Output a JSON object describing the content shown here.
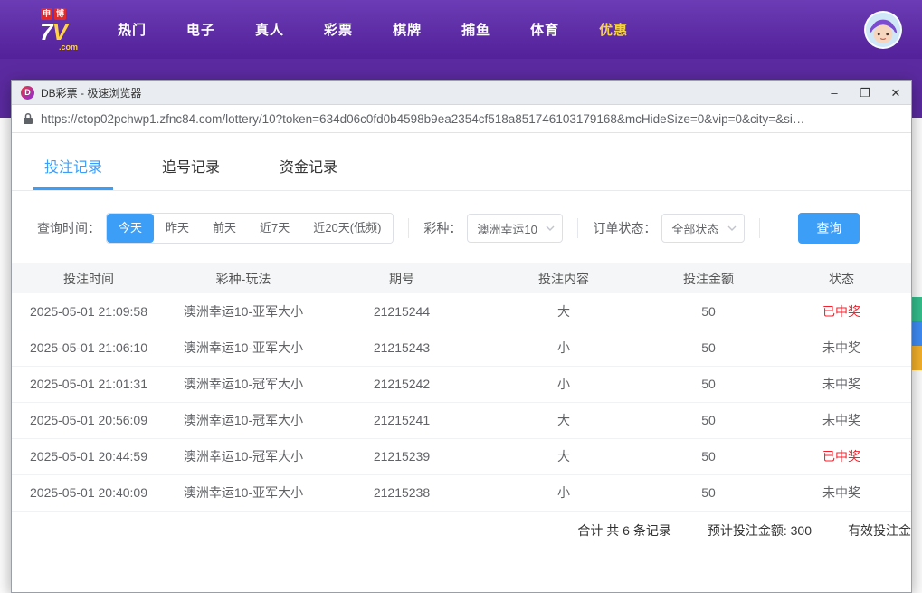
{
  "topbar": {
    "logo": {
      "badge1": "申",
      "badge2": "博",
      "main": "7",
      "main_v": "V",
      "com": ".com"
    },
    "nav": [
      {
        "label": "热门"
      },
      {
        "label": "电子"
      },
      {
        "label": "真人"
      },
      {
        "label": "彩票"
      },
      {
        "label": "棋牌"
      },
      {
        "label": "捕鱼"
      },
      {
        "label": "体育"
      },
      {
        "label": "优惠"
      }
    ]
  },
  "browser": {
    "title": "DB彩票 - 极速浏览器",
    "icon_letter": "D",
    "url": "https://ctop02pchwp1.zfnc84.com/lottery/10?token=634d06c0fd0b4598b9ea2354cf518a851746103179168&mcHideSize=0&vip=0&city=&si…",
    "controls": {
      "minimize": "–",
      "maximize": "❐",
      "close": "✕"
    }
  },
  "tabs": [
    {
      "label": "投注记录",
      "active": true
    },
    {
      "label": "追号记录",
      "active": false
    },
    {
      "label": "资金记录",
      "active": false
    }
  ],
  "filters": {
    "time_label": "查询时间：",
    "time_options": [
      {
        "label": "今天",
        "active": true
      },
      {
        "label": "昨天",
        "active": false
      },
      {
        "label": "前天",
        "active": false
      },
      {
        "label": "近7天",
        "active": false
      },
      {
        "label": "近20天(低频)",
        "active": false
      }
    ],
    "lottery_label": "彩种：",
    "lottery_value": "澳洲幸运10",
    "status_label": "订单状态：",
    "status_value": "全部状态",
    "query_button": "查询"
  },
  "table": {
    "headers": [
      "投注时间",
      "彩种-玩法",
      "期号",
      "投注内容",
      "投注金额",
      "状态"
    ],
    "rows": [
      {
        "time": "2025-05-01 21:09:58",
        "game": "澳洲幸运10-亚军大小",
        "issue": "21215244",
        "content": "大",
        "amount": "50",
        "status": "已中奖",
        "won": true
      },
      {
        "time": "2025-05-01 21:06:10",
        "game": "澳洲幸运10-亚军大小",
        "issue": "21215243",
        "content": "小",
        "amount": "50",
        "status": "未中奖",
        "won": false
      },
      {
        "time": "2025-05-01 21:01:31",
        "game": "澳洲幸运10-冠军大小",
        "issue": "21215242",
        "content": "小",
        "amount": "50",
        "status": "未中奖",
        "won": false
      },
      {
        "time": "2025-05-01 20:56:09",
        "game": "澳洲幸运10-冠军大小",
        "issue": "21215241",
        "content": "大",
        "amount": "50",
        "status": "未中奖",
        "won": false
      },
      {
        "time": "2025-05-01 20:44:59",
        "game": "澳洲幸运10-冠军大小",
        "issue": "21215239",
        "content": "大",
        "amount": "50",
        "status": "已中奖",
        "won": true
      },
      {
        "time": "2025-05-01 20:40:09",
        "game": "澳洲幸运10-亚军大小",
        "issue": "21215238",
        "content": "小",
        "amount": "50",
        "status": "未中奖",
        "won": false
      }
    ]
  },
  "summary": {
    "total": "合计 共 6 条记录",
    "expected": "预计投注金额: 300",
    "valid_partial": "有效投注金"
  },
  "colors": {
    "accent_blue": "#3d9ef7",
    "won_red": "#f5222d",
    "topbar_purple": "#5b2aa0"
  }
}
